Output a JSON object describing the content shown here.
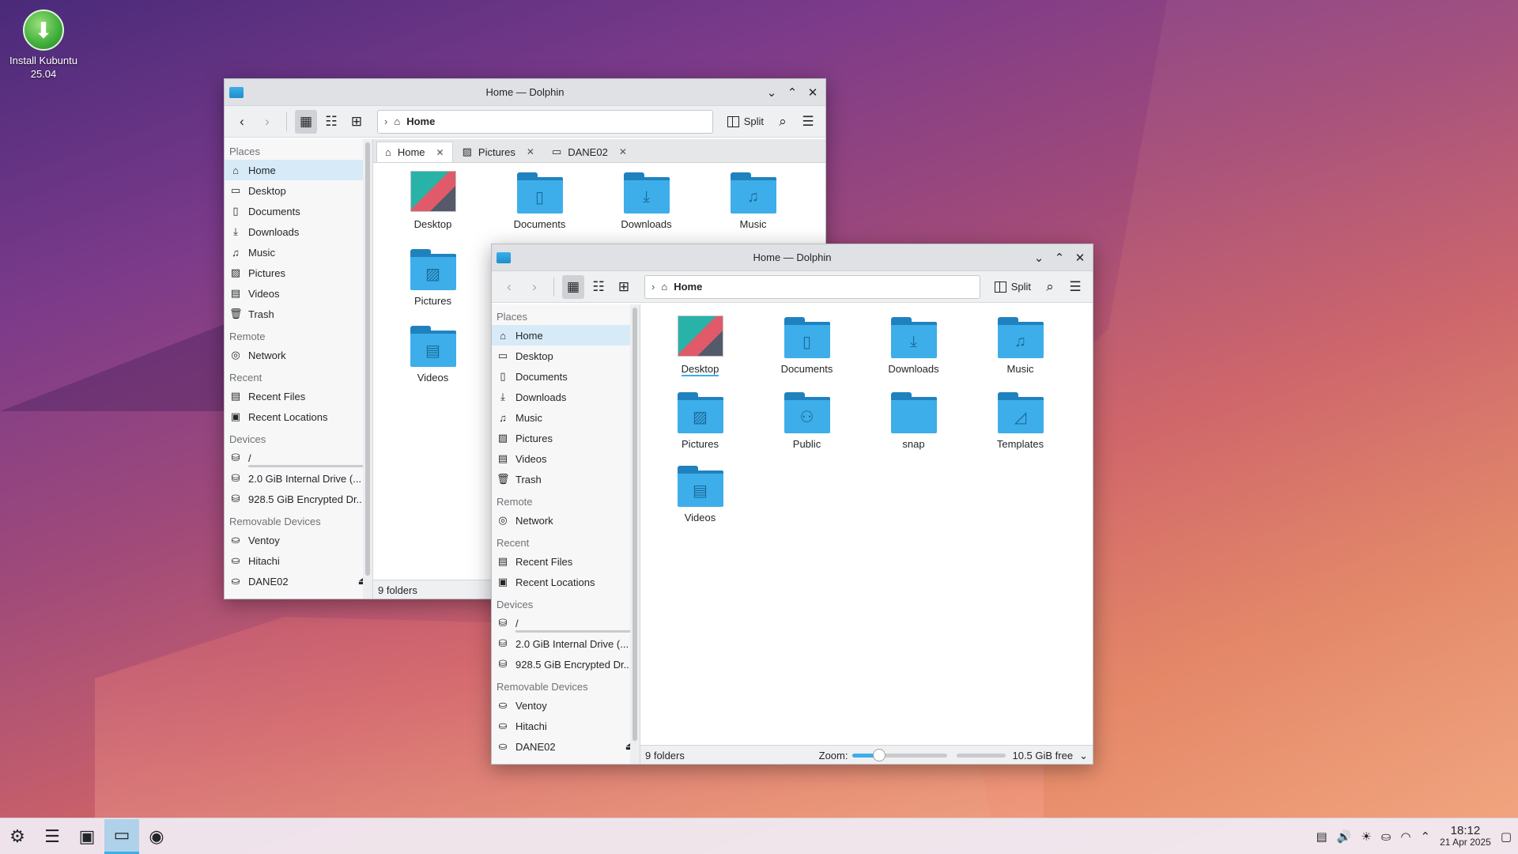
{
  "desktop": {
    "icon_label": "Install Kubuntu 25.04"
  },
  "window_back": {
    "title": "Home — Dolphin",
    "address": "Home",
    "split_label": "Split",
    "tabs": [
      {
        "label": "Home"
      },
      {
        "label": "Pictures"
      },
      {
        "label": "DANE02"
      }
    ],
    "items": [
      "Desktop",
      "Documents",
      "Downloads",
      "Music",
      "Pictures",
      "Videos"
    ],
    "status": "9 folders"
  },
  "window_front": {
    "title": "Home — Dolphin",
    "address": "Home",
    "split_label": "Split",
    "items": [
      "Desktop",
      "Documents",
      "Downloads",
      "Music",
      "Pictures",
      "Public",
      "snap",
      "Templates",
      "Videos"
    ],
    "status": "9 folders",
    "zoom_label": "Zoom:",
    "zoom_fraction": 0.28,
    "free_space": "10.5 GiB free"
  },
  "sidebar": {
    "places_header": "Places",
    "places": [
      "Home",
      "Desktop",
      "Documents",
      "Downloads",
      "Music",
      "Pictures",
      "Videos",
      "Trash"
    ],
    "remote_header": "Remote",
    "remote": [
      "Network"
    ],
    "recent_header": "Recent",
    "recent": [
      "Recent Files",
      "Recent Locations"
    ],
    "devices_header": "Devices",
    "devices": [
      "/",
      "2.0 GiB Internal Drive (...",
      "928.5 GiB Encrypted Dr..."
    ],
    "removable_header": "Removable Devices",
    "removable": [
      "Ventoy",
      "Hitachi",
      "DANE02"
    ]
  },
  "taskbar": {
    "time": "18:12",
    "date": "21 Apr 2025"
  },
  "colors": {
    "accent": "#3daee9",
    "folder": "#3daee9",
    "folder_dark": "#1f82bf",
    "selection": "#d7eaf7"
  }
}
